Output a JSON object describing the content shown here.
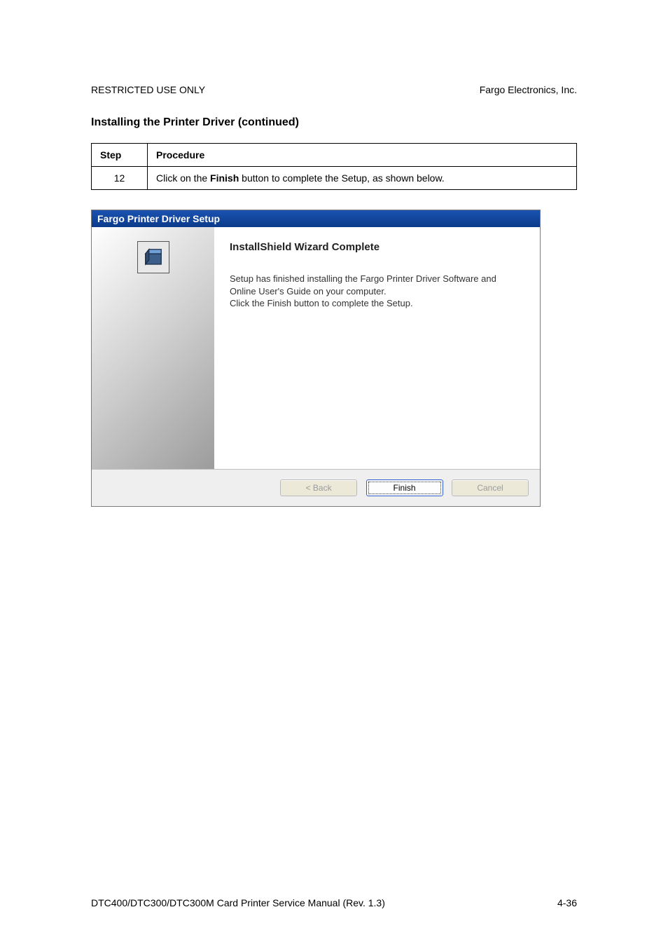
{
  "header": {
    "left": "RESTRICTED USE ONLY",
    "right": "Fargo Electronics, Inc."
  },
  "section_title": "Installing the Printer Driver (continued)",
  "table": {
    "col1": "Step",
    "col2": "Procedure",
    "row": {
      "step": "12",
      "text_before": "Click on the ",
      "bold": "Finish",
      "text_after": " button to complete the Setup, as shown below."
    }
  },
  "dialog": {
    "title": "Fargo Printer Driver Setup",
    "heading": "InstallShield Wizard Complete",
    "para1": "Setup has finished installing the Fargo Printer Driver Software and Online User's Guide on your computer.",
    "para2": "Click the Finish button to complete the Setup.",
    "buttons": {
      "back": "< Back",
      "finish": "Finish",
      "cancel": "Cancel"
    }
  },
  "footer": {
    "left": "DTC400/DTC300/DTC300M Card Printer Service Manual (Rev. 1.3)",
    "right": "4-36"
  }
}
